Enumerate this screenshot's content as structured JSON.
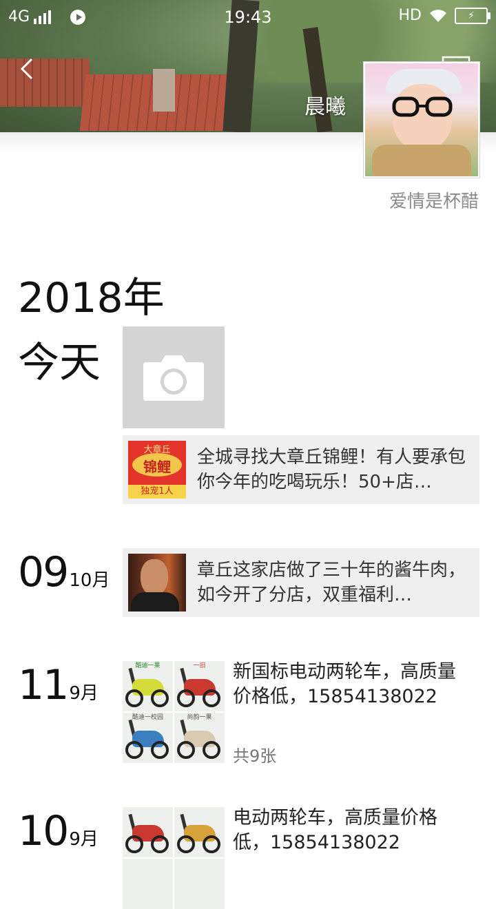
{
  "status_bar": {
    "network": "4G",
    "time": "19:43",
    "hd": "HD"
  },
  "header": {
    "nickname": "晨曦",
    "signature": "爱情是杯醋"
  },
  "timeline": {
    "year": "2018年",
    "today_label": "今天",
    "today_share": {
      "thumb_top": "大章丘",
      "thumb_mid": "锦鲤",
      "thumb_bottom": "独宠1人",
      "text": "全城寻找大章丘锦鲤！有人要承包你今年的吃喝玩乐！50+店…"
    },
    "entries": [
      {
        "day": "09",
        "month": "10月",
        "type": "share",
        "text": "章丘这家店做了三十年的酱牛肉，如今开了分店，双重福利…"
      },
      {
        "day": "11",
        "month": "9月",
        "type": "photos",
        "text": "新国标电动两轮车，高质量价格低，15854138022",
        "count": "共9张",
        "banners": [
          "酷迪一果",
          "一旧",
          "酷迪一校园",
          "尚韵一果"
        ]
      },
      {
        "day": "10",
        "month": "9月",
        "type": "photos",
        "text": "电动两轮车，高质量价格低，15854138022"
      }
    ]
  },
  "colors": {
    "accent_text": "#111111",
    "muted_text": "#8a8a8a",
    "card_bg": "#efefef",
    "camera_tile_bg": "#d4d4d4"
  },
  "icons": [
    "back-arrow-icon",
    "message-icon",
    "camera-icon",
    "wifi-icon",
    "battery-icon",
    "signal-icon",
    "record-icon"
  ]
}
